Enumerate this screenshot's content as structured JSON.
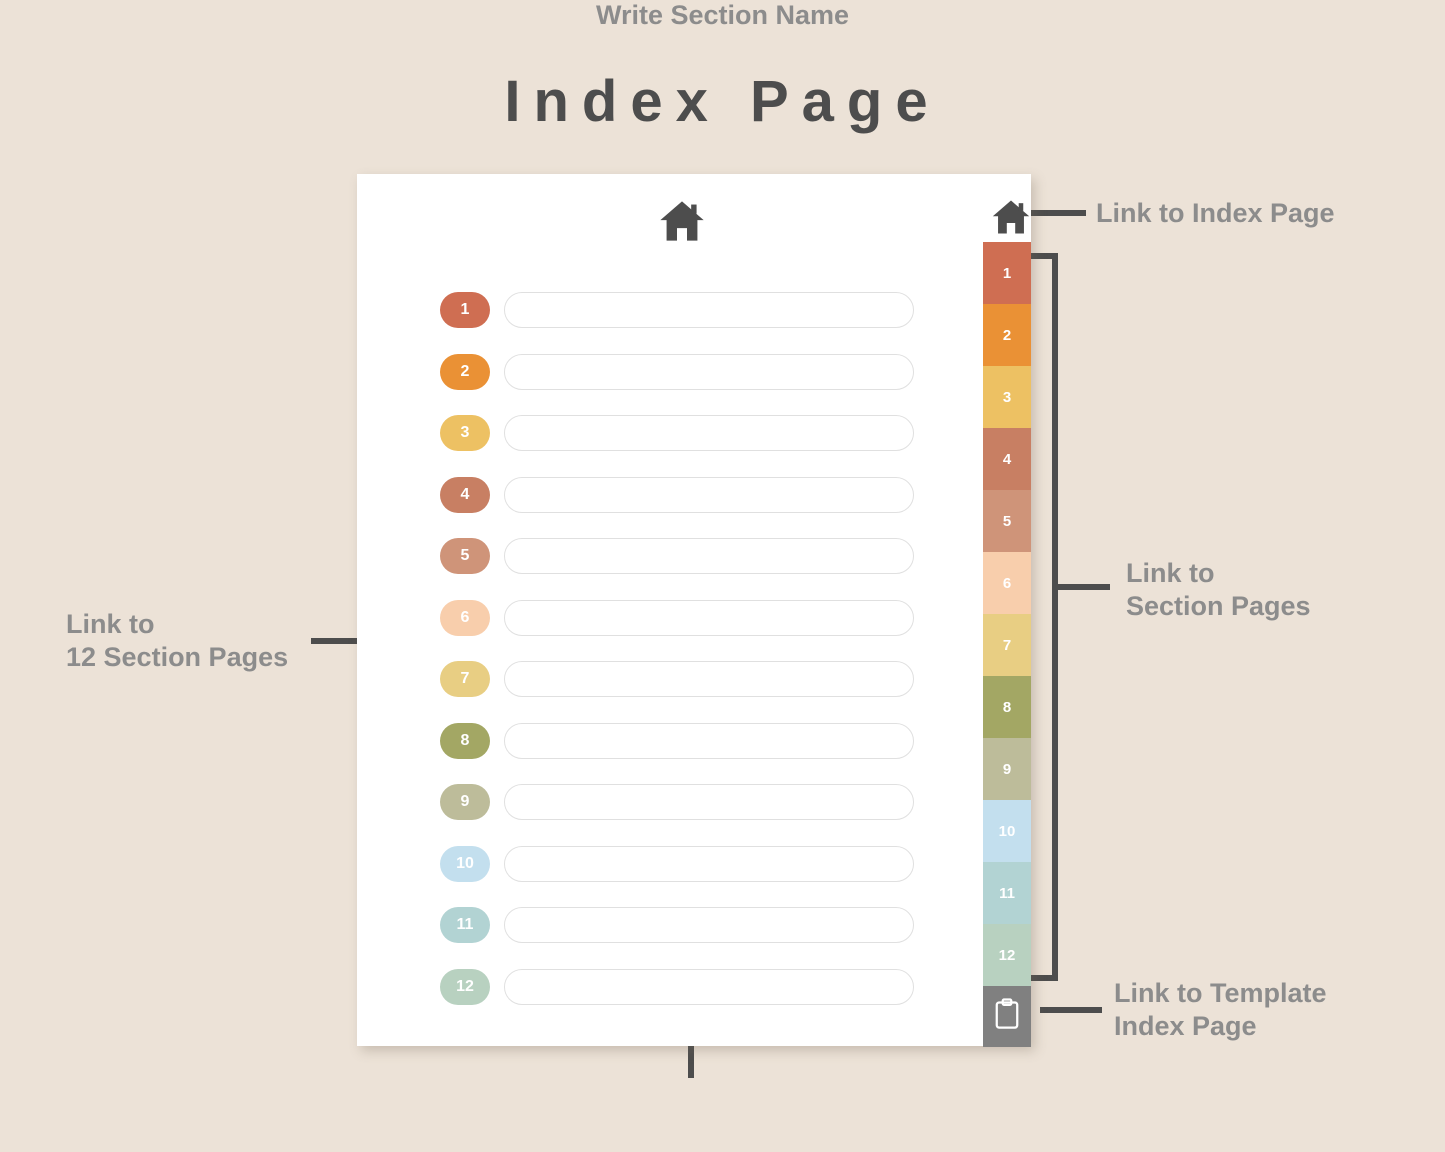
{
  "title": "Index Page",
  "background_color": "#ece2d7",
  "accent_text_color": "#8c8c8c",
  "line_color": "#4d4d4d",
  "card": {
    "home_icon_main": "home-icon",
    "home_icon_tab": "home-icon",
    "template_icon": "clipboard-icon"
  },
  "rows": [
    {
      "number": "1",
      "color": "#cf6e52",
      "field_value": "",
      "field_placeholder": ""
    },
    {
      "number": "2",
      "color": "#ea9135",
      "field_value": "",
      "field_placeholder": ""
    },
    {
      "number": "3",
      "color": "#edc163",
      "field_value": "",
      "field_placeholder": ""
    },
    {
      "number": "4",
      "color": "#c87f63",
      "field_value": "",
      "field_placeholder": ""
    },
    {
      "number": "5",
      "color": "#cf9479",
      "field_value": "",
      "field_placeholder": ""
    },
    {
      "number": "6",
      "color": "#f8ceac",
      "field_value": "",
      "field_placeholder": ""
    },
    {
      "number": "7",
      "color": "#e8ce83",
      "field_value": "",
      "field_placeholder": ""
    },
    {
      "number": "8",
      "color": "#a3a764",
      "field_value": "",
      "field_placeholder": ""
    },
    {
      "number": "9",
      "color": "#bdbc9a",
      "field_value": "",
      "field_placeholder": ""
    },
    {
      "number": "10",
      "color": "#c3dfee",
      "field_value": "",
      "field_placeholder": ""
    },
    {
      "number": "11",
      "color": "#b2d3d3",
      "field_value": "",
      "field_placeholder": ""
    },
    {
      "number": "12",
      "color": "#b8d1c0",
      "field_value": "",
      "field_placeholder": ""
    }
  ],
  "tabs": [
    {
      "number": "1",
      "color": "#cf6e52"
    },
    {
      "number": "2",
      "color": "#ea9135"
    },
    {
      "number": "3",
      "color": "#edc163"
    },
    {
      "number": "4",
      "color": "#c87f63"
    },
    {
      "number": "5",
      "color": "#cf9479"
    },
    {
      "number": "6",
      "color": "#f8ceac"
    },
    {
      "number": "7",
      "color": "#e8ce83"
    },
    {
      "number": "8",
      "color": "#a3a764"
    },
    {
      "number": "9",
      "color": "#bdbc9a"
    },
    {
      "number": "10",
      "color": "#c3dfee"
    },
    {
      "number": "11",
      "color": "#b2d3d3"
    },
    {
      "number": "12",
      "color": "#b8d1c0"
    }
  ],
  "template_tab": {
    "color": "#808080",
    "icon": "clipboard-icon"
  },
  "annotations": {
    "left_sections": "Link to\n12 Section Pages",
    "index_page": "Link to Index Page",
    "section_pages": "Link to\nSection Pages",
    "template_index": "Link to Template\nIndex Page",
    "write_section_name": "Write Section Name"
  }
}
